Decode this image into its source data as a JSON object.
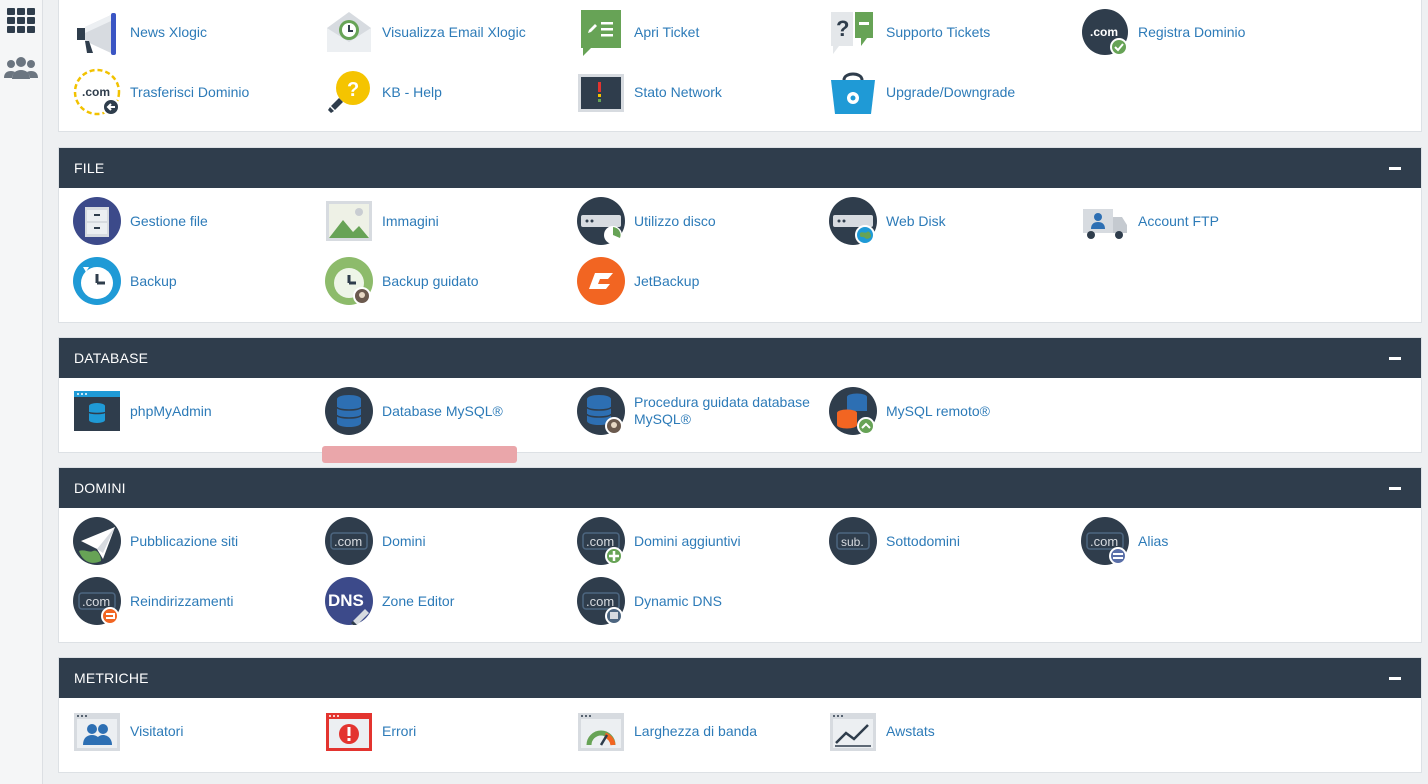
{
  "sidebar": {
    "icons": [
      {
        "name": "grid-icon"
      },
      {
        "name": "users-icon"
      }
    ]
  },
  "colors": {
    "header_bg": "#2f3d4c",
    "link": "#2d7bb8",
    "highlight": "#eaa6aa"
  },
  "sections": {
    "top": {
      "items": [
        {
          "label": "News Xlogic",
          "icon": "megaphone-icon"
        },
        {
          "label": "Visualizza Email Xlogic",
          "icon": "email-clock-icon"
        },
        {
          "label": "Apri Ticket",
          "icon": "ticket-icon"
        },
        {
          "label": "Supporto Tickets",
          "icon": "support-ticket-icon"
        },
        {
          "label": "Registra Dominio",
          "icon": "domain-check-icon"
        },
        {
          "label": "Trasferisci Dominio",
          "icon": "domain-transfer-icon"
        },
        {
          "label": "KB - Help",
          "icon": "lightbulb-icon"
        },
        {
          "label": "Stato Network",
          "icon": "network-status-icon"
        },
        {
          "label": "Upgrade/Downgrade",
          "icon": "shopping-bag-icon"
        }
      ]
    },
    "file": {
      "title": "FILE",
      "items": [
        {
          "label": "Gestione file",
          "icon": "file-cabinet-icon"
        },
        {
          "label": "Immagini",
          "icon": "image-icon"
        },
        {
          "label": "Utilizzo disco",
          "icon": "disk-usage-icon"
        },
        {
          "label": "Web Disk",
          "icon": "web-disk-icon"
        },
        {
          "label": "Account FTP",
          "icon": "ftp-truck-icon"
        },
        {
          "label": "Backup",
          "icon": "backup-icon"
        },
        {
          "label": "Backup guidato",
          "icon": "backup-wizard-icon"
        },
        {
          "label": "JetBackup",
          "icon": "jetbackup-icon"
        }
      ]
    },
    "database": {
      "title": "DATABASE",
      "items": [
        {
          "label": "phpMyAdmin",
          "icon": "phpmyadmin-icon"
        },
        {
          "label": "Database MySQL®",
          "icon": "database-icon"
        },
        {
          "label": "Procedura guidata database MySQL®",
          "icon": "database-wizard-icon"
        },
        {
          "label": "MySQL remoto®",
          "icon": "remote-database-icon"
        }
      ]
    },
    "domini": {
      "title": "DOMINI",
      "items": [
        {
          "label": "Pubblicazione siti",
          "icon": "paper-plane-globe-icon"
        },
        {
          "label": "Domini",
          "icon": "dotcom-icon"
        },
        {
          "label": "Domini aggiuntivi",
          "icon": "dotcom-add-icon"
        },
        {
          "label": "Sottodomini",
          "icon": "subdomain-icon"
        },
        {
          "label": "Alias",
          "icon": "dotcom-alias-icon"
        },
        {
          "label": "Reindirizzamenti",
          "icon": "dotcom-redirect-icon"
        },
        {
          "label": "Zone Editor",
          "icon": "dns-icon"
        },
        {
          "label": "Dynamic DNS",
          "icon": "dynamic-dns-icon"
        }
      ]
    },
    "metriche": {
      "title": "METRICHE",
      "items": [
        {
          "label": "Visitatori",
          "icon": "visitors-icon"
        },
        {
          "label": "Errori",
          "icon": "error-icon"
        },
        {
          "label": "Larghezza di banda",
          "icon": "bandwidth-gauge-icon"
        },
        {
          "label": "Awstats",
          "icon": "awstats-chart-icon"
        }
      ]
    }
  }
}
